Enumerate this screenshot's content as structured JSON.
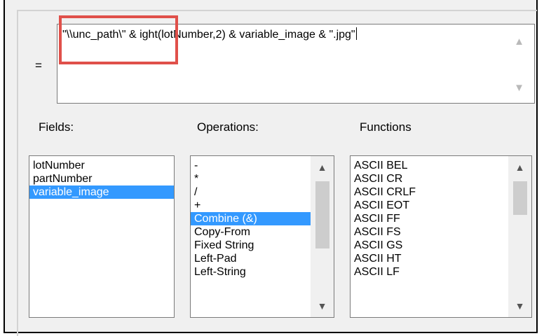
{
  "expression": {
    "equals_label": "=",
    "text": "\"\\\\unc_path\\\" & ight(lotNumber,2) & variable_image & \".jpg\""
  },
  "labels": {
    "fields": "Fields:",
    "operations": "Operations:",
    "functions": "Functions"
  },
  "fields": {
    "items": [
      "lotNumber",
      "partNumber",
      "variable_image"
    ],
    "selected": "variable_image"
  },
  "operations": {
    "items": [
      "-",
      "*",
      "/",
      "+",
      "Combine (&)",
      "Copy-From",
      "Fixed String",
      "Left-Pad",
      "Left-String"
    ],
    "selected": "Combine (&)"
  },
  "functions": {
    "items": [
      "ASCII BEL",
      "ASCII CR",
      "ASCII CRLF",
      "ASCII EOT",
      "ASCII FF",
      "ASCII FS",
      "ASCII GS",
      "ASCII HT",
      "ASCII LF"
    ]
  },
  "colors": {
    "selection": "#3399ff",
    "highlight": "#e0504a",
    "dialog_bg": "#f0f0f0"
  },
  "icons": {
    "scroll_up": "chevron-up-icon",
    "scroll_down": "chevron-down-icon"
  }
}
